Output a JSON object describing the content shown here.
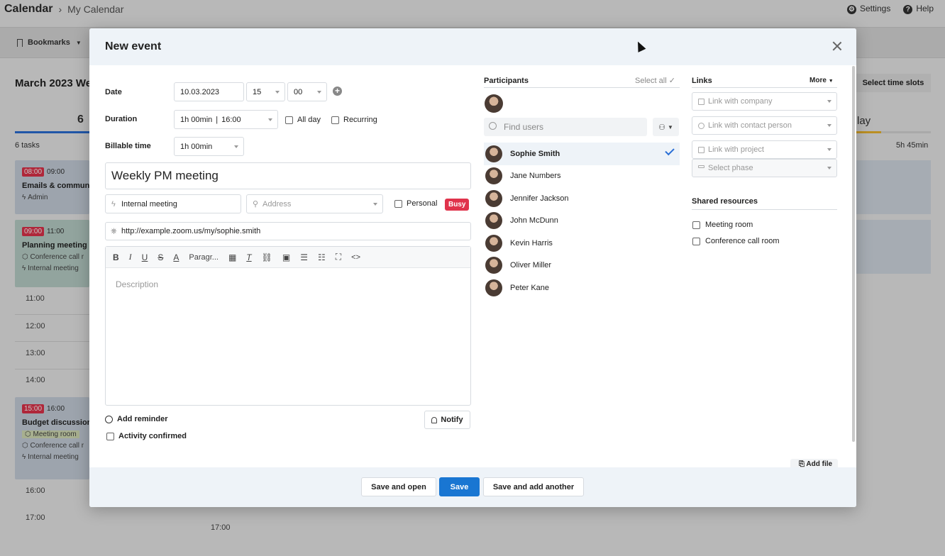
{
  "app": {
    "title": "Calendar",
    "breadcrumb": "My Calendar",
    "settings_label": "Settings",
    "help_label": "Help",
    "bookmarks_label": "Bookmarks",
    "month_title": "March 2023 We",
    "day_number": "6",
    "tasks_count": "6 tasks",
    "events": [
      {
        "start": "08:00",
        "end": "09:00",
        "name": "Emails & communi",
        "sub1": "Admin"
      },
      {
        "start": "09:00",
        "end": "11:00",
        "name": "Planning meeting",
        "sub1": "Conference call r",
        "sub2": "Internal meeting"
      },
      {
        "start": "15:00",
        "end": "16:00",
        "name": "Budget discussion",
        "sub1": "Meeting room",
        "sub2": "Conference call r",
        "sub3": "Internal meeting"
      }
    ],
    "hours": [
      "11:00",
      "12:00",
      "13:00",
      "14:00",
      "16:00",
      "17:00"
    ],
    "bottom_hour": "17:00",
    "select_time_slots": "Select time slots",
    "right_day": "lay",
    "right_hours": "5h 45min"
  },
  "modal": {
    "title": "New event",
    "date_label": "Date",
    "date_value": "10.03.2023",
    "hour_value": "15",
    "minute_value": "00",
    "duration_label": "Duration",
    "duration_value": "1h 00min",
    "duration_end": "16:00",
    "all_day_label": "All day",
    "recurring_label": "Recurring",
    "billable_label": "Billable time",
    "billable_value": "1h 00min",
    "event_title": "Weekly PM meeting",
    "event_type": "Internal meeting",
    "address_placeholder": "Address",
    "personal_label": "Personal",
    "busy_label": "Busy",
    "url_value": "http://example.zoom.us/my/sophie.smith",
    "toolbar": {
      "bold": "B",
      "italic": "I",
      "underline": "U",
      "strike": "S",
      "color": "A",
      "paragraph": "Paragr...",
      "clear": "T",
      "code": "<>"
    },
    "description_placeholder": "Description",
    "add_reminder_label": "Add reminder",
    "notify_label": "Notify",
    "activity_confirmed_label": "Activity confirmed",
    "participants": {
      "heading": "Participants",
      "select_all": "Select all",
      "find_placeholder": "Find users",
      "users": [
        "Sophie Smith",
        "Jane Numbers",
        "Jennifer Jackson",
        "John McDunn",
        "Kevin Harris",
        "Oliver Miller",
        "Peter Kane"
      ]
    },
    "links": {
      "heading": "Links",
      "more": "More",
      "company": "Link with company",
      "contact": "Link with contact person",
      "project": "Link with project",
      "phase": "Select phase"
    },
    "shared": {
      "heading": "Shared resources",
      "meeting_room": "Meeting room",
      "conference_room": "Conference call room"
    },
    "add_file": "Add file",
    "footer": {
      "save_open": "Save and open",
      "save": "Save",
      "save_another": "Save and add another"
    }
  },
  "colors": {
    "primary": "#1976d2",
    "danger": "#e0334b",
    "header_bg": "#eef3f8"
  }
}
